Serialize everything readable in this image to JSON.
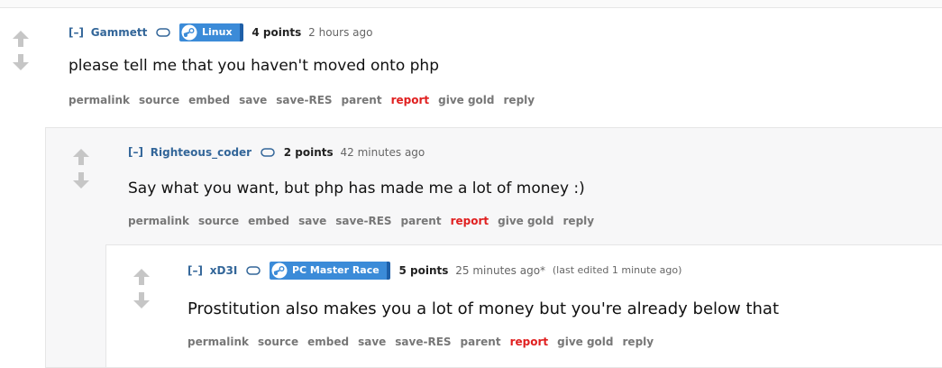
{
  "comments": [
    {
      "collapse": "[–]",
      "author": "Gammett",
      "flair": "Linux",
      "score": "4 points",
      "time": "2 hours ago",
      "edited": "",
      "body": "please tell me that you haven't moved onto php"
    },
    {
      "collapse": "[–]",
      "author": "Righteous_coder",
      "flair": "",
      "score": "2 points",
      "time": "42 minutes ago",
      "edited": "",
      "body": "Say what you want, but php has made me a lot of money :)"
    },
    {
      "collapse": "[–]",
      "author": "xD3I",
      "flair": "PC Master Race",
      "score": "5 points",
      "time": "25 minutes ago*",
      "edited": "(last edited 1 minute ago)",
      "body": "Prostitution also makes you a lot of money but you're already below that"
    }
  ],
  "buttons": {
    "permalink": "permalink",
    "source": "source",
    "embed": "embed",
    "save": "save",
    "save_res": "save-RES",
    "parent": "parent",
    "report": "report",
    "give_gold": "give gold",
    "reply": "reply"
  },
  "colors": {
    "author": "#336699",
    "report": "#e02020",
    "flair": "#3b8bd8",
    "nest_bg": "#f7f7f8"
  },
  "icons": [
    "upvote-arrow-icon",
    "downvote-arrow-icon",
    "chat-bubble-icon",
    "steam-logo-icon"
  ]
}
